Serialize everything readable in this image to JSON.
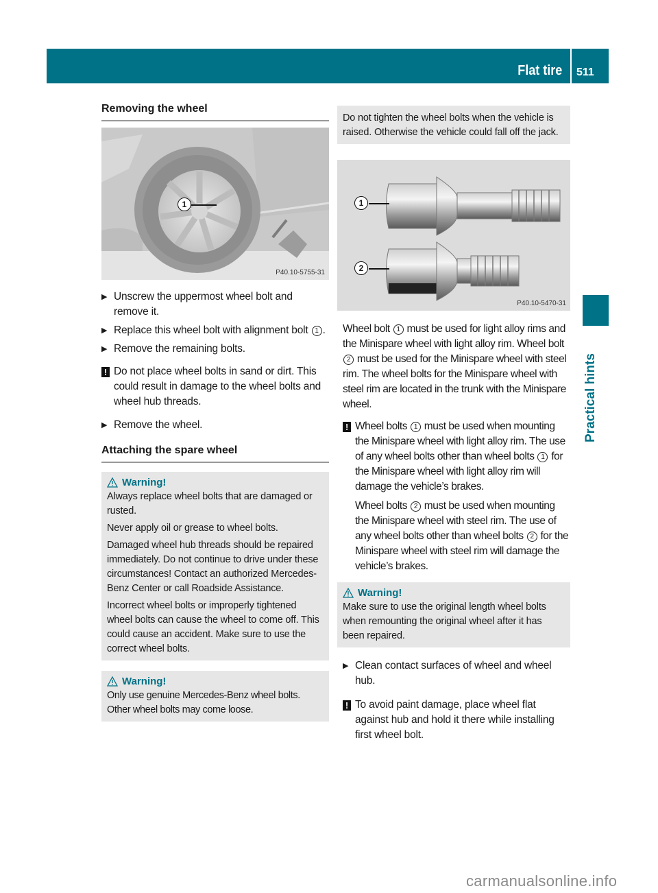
{
  "header": {
    "title": "Flat tire",
    "page_number": "511"
  },
  "side_tab": {
    "label": "Practical hints"
  },
  "left": {
    "heading_removing": "Removing the wheel",
    "figure1": {
      "code": "P40.10-5755-31",
      "callout": "1"
    },
    "steps_removing": [
      "Unscrew the uppermost wheel bolt and remove it.",
      "Replace this wheel bolt with alignment bolt",
      "Remove the remaining bolts."
    ],
    "step2_suffix": ".",
    "callout_1": "1",
    "note_dirt": "Do not place wheel bolts in sand or dirt. This could result in damage to the wheel bolts and wheel hub threads.",
    "step_remove_wheel": "Remove the wheel.",
    "heading_attaching": "Attaching the spare wheel",
    "warning1": {
      "title": "Warning!",
      "paragraphs": [
        "Always replace wheel bolts that are damaged or rusted.",
        "Never apply oil or grease to wheel bolts.",
        "Damaged wheel hub threads should be repaired immediately. Do not continue to drive under these circumstances! Contact an authorized Mercedes-Benz Center or call Roadside Assistance.",
        "Incorrect wheel bolts or improperly tightened wheel bolts can cause the wheel to come off. This could cause an accident. Make sure to use the correct wheel bolts."
      ]
    },
    "warning2": {
      "title": "Warning!",
      "paragraphs": [
        "Only use genuine Mercedes-Benz wheel bolts. Other wheel bolts may come loose."
      ]
    }
  },
  "right": {
    "warning_cont": "Do not tighten the wheel bolts when the vehicle is raised. Otherwise the vehicle could fall off the jack.",
    "figure2": {
      "code": "P40.10-5470-31",
      "callout1": "1",
      "callout2": "2"
    },
    "para_bolts": {
      "a1": "Wheel bolt",
      "c1": "1",
      "a2": "must be used for light alloy rims and the Minispare wheel with light alloy rim. Wheel bolt",
      "c2": "2",
      "a3": "must be used for the Minispare wheel with steel rim. The wheel bolts for the Minispare wheel with steel rim are located in the trunk with the Minispare wheel."
    },
    "note_bolts": {
      "a1": "Wheel bolts",
      "c1": "1",
      "a2": "must be used when mounting the Minispare wheel with light alloy rim. The use of any wheel bolts other than wheel bolts",
      "c2": "1",
      "a3": "for the Minispare wheel with light alloy rim will damage the vehicle’s brakes.",
      "b1": "Wheel bolts",
      "d1": "2",
      "b2": "must be used when mounting the Minispare wheel with steel rim. The use of any wheel bolts other than wheel bolts",
      "d2": "2",
      "b3": "for the Minispare wheel with steel rim will damage the vehicle’s brakes."
    },
    "warning3": {
      "title": "Warning!",
      "paragraphs": [
        "Make sure to use the original length wheel bolts when remounting the original wheel after it has been repaired."
      ]
    },
    "step_clean": "Clean contact surfaces of wheel and wheel hub.",
    "note_paint": "To avoid paint damage, place wheel flat against hub and hold it there while installing first wheel bolt."
  },
  "icons": {
    "step_arrow": "▶",
    "note_bang": "!"
  },
  "watermark": "carmanualsonline.info",
  "colors": {
    "accent": "#007287",
    "warning_bg": "#e6e6e6"
  }
}
